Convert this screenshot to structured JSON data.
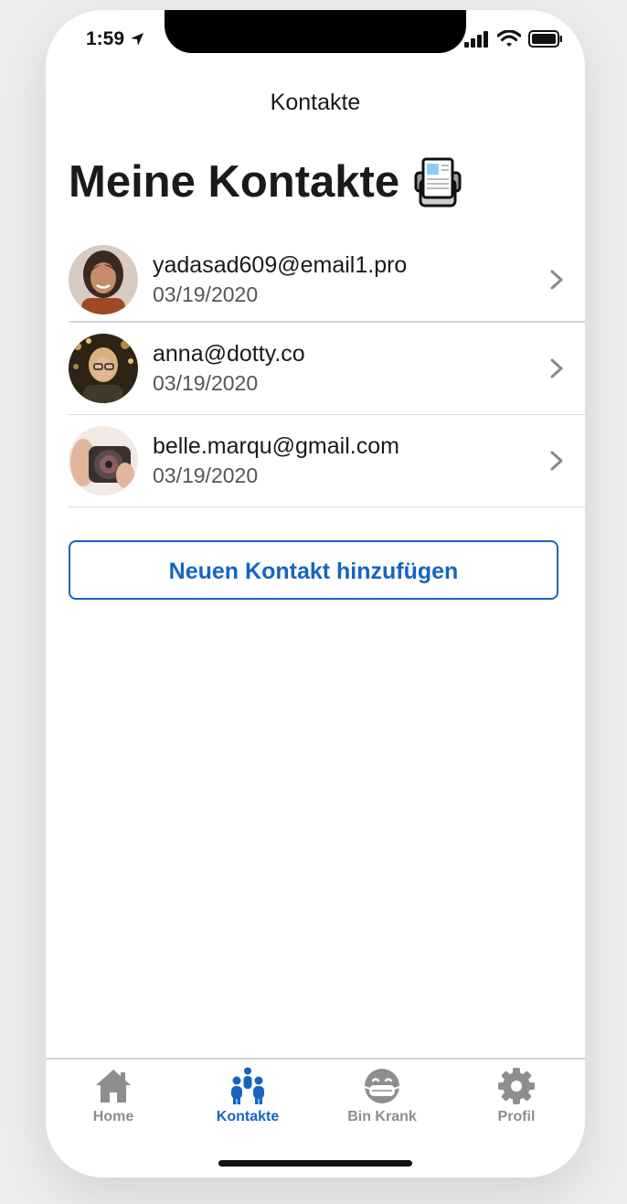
{
  "status_bar": {
    "time": "1:59"
  },
  "nav": {
    "title": "Kontakte"
  },
  "page": {
    "title": "Meine Kontakte"
  },
  "contacts": [
    {
      "email": "yadasad609@email1.pro",
      "date": "03/19/2020"
    },
    {
      "email": "anna@dotty.co",
      "date": "03/19/2020"
    },
    {
      "email": "belle.marqu@gmail.com",
      "date": "03/19/2020"
    }
  ],
  "add_button": {
    "label": "Neuen Kontakt hinzufügen"
  },
  "tabs": [
    {
      "label": "Home",
      "icon": "home-icon",
      "active": false
    },
    {
      "label": "Kontakte",
      "icon": "contacts-icon",
      "active": true
    },
    {
      "label": "Bin Krank",
      "icon": "sick-face-icon",
      "active": false
    },
    {
      "label": "Profil",
      "icon": "gear-icon",
      "active": false
    }
  ],
  "colors": {
    "accent": "#1565c0",
    "inactive": "#8e8e8e",
    "text": "#1a1a1a"
  }
}
